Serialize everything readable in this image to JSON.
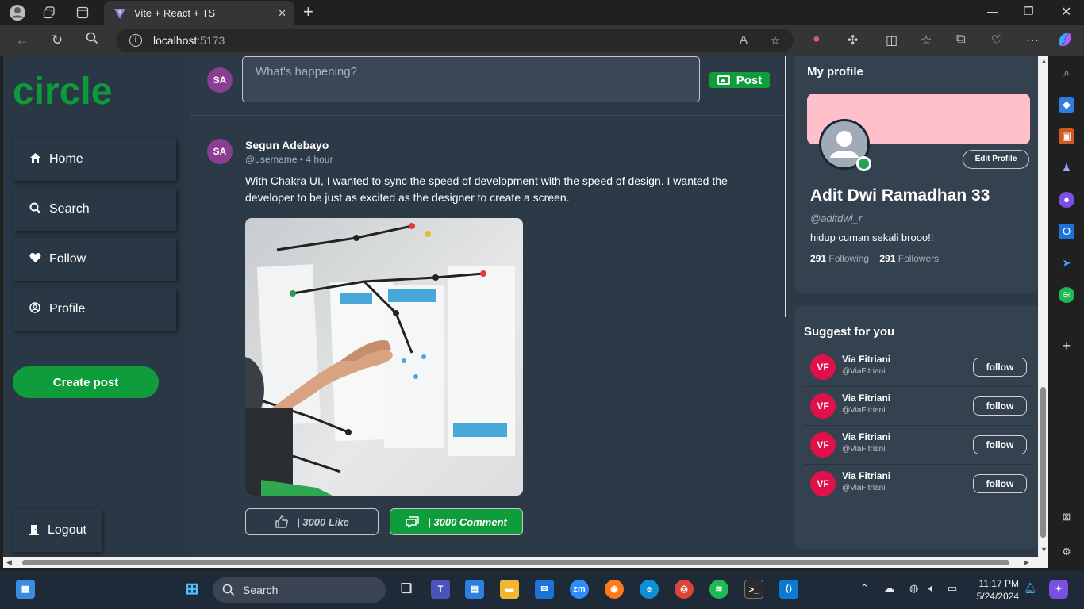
{
  "browser": {
    "tab_title": "Vite + React + TS",
    "url_host": "localhost",
    "url_port": ":5173"
  },
  "nav": {
    "logo": "circle",
    "items": [
      {
        "label": "Home",
        "icon": "home-icon"
      },
      {
        "label": "Search",
        "icon": "search-icon"
      },
      {
        "label": "Follow",
        "icon": "heart-icon"
      },
      {
        "label": "Profile",
        "icon": "user-circle-icon"
      }
    ],
    "create_post": "Create post",
    "logout": "Logout"
  },
  "composer": {
    "avatar_initials": "SA",
    "placeholder": "What's happening?",
    "post_label": "Post"
  },
  "post": {
    "avatar_initials": "SA",
    "author": "Segun Adebayo",
    "meta": "@username • 4 hour",
    "text": "With Chakra UI, I wanted to sync the speed of development with the speed of design. I wanted the developer to be just as excited as the designer to create a screen.",
    "like_label": "| 3000 Like",
    "comment_label": "| 3000 Comment"
  },
  "profile": {
    "heading": "My profile",
    "edit_label": "Edit Profile",
    "name": "Adit Dwi Ramadhan 33",
    "handle": "@aditdwi_r",
    "bio": "hidup cuman sekali brooo!!",
    "following_count": "291",
    "following_label": "Following",
    "followers_count": "291",
    "followers_label": "Followers"
  },
  "suggest": {
    "heading": "Suggest for you",
    "items": [
      {
        "initials": "VF",
        "name": "Via Fitriani",
        "handle": "@ViaFitriani",
        "button": "follow"
      },
      {
        "initials": "VF",
        "name": "Via Fitriani",
        "handle": "@ViaFitriani",
        "button": "follow"
      },
      {
        "initials": "VF",
        "name": "Via Fitriani",
        "handle": "@ViaFitriani",
        "button": "follow"
      },
      {
        "initials": "VF",
        "name": "Via Fitriani",
        "handle": "@ViaFitriani",
        "button": "follow"
      }
    ]
  },
  "taskbar": {
    "search_label": "Search",
    "time": "11:17 PM",
    "date": "5/24/2024"
  },
  "colors": {
    "accent_green": "#0e9d3a",
    "page_bg": "#2c3a48",
    "cover_pink": "#ffc0cb",
    "suggest_avatar": "#e0114a"
  }
}
